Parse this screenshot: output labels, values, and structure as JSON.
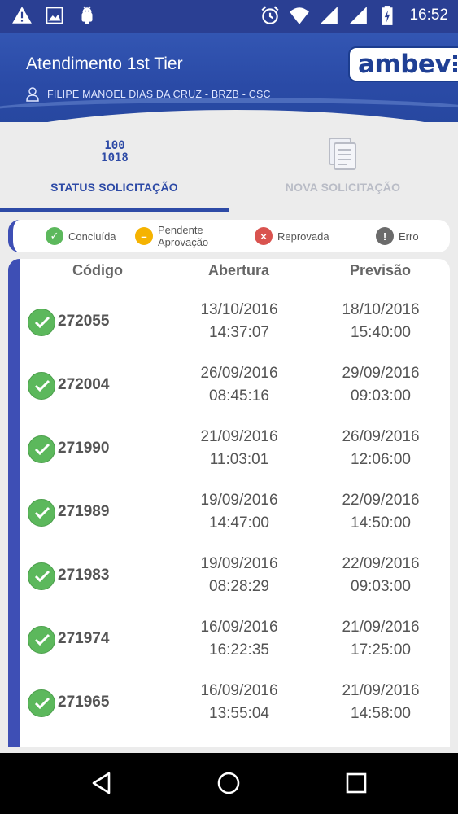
{
  "status_bar": {
    "time": "16:52",
    "left_icons": [
      "warning-icon",
      "image-icon",
      "android-icon"
    ],
    "right_icons": [
      "alarm-icon",
      "wifi-icon",
      "signal-icon",
      "signal-icon",
      "battery-charging-icon"
    ]
  },
  "header": {
    "title": "Atendimento 1st Tier",
    "user": "FILIPE MANOEL DIAS DA CRUZ - BRZB - CSC",
    "logo": "ambev"
  },
  "tabs": [
    {
      "label": "STATUS SOLICITAÇÃO",
      "icon": "binary-icon",
      "active": true,
      "icon_text_top": "100",
      "icon_text_bottom": "1018"
    },
    {
      "label": "NOVA SOLICITAÇÃO",
      "icon": "document-icon",
      "active": false
    }
  ],
  "legend": [
    {
      "label": "Concluída",
      "color": "#5cb85c",
      "glyph": "✓"
    },
    {
      "label": "Pendente Aprovação",
      "color": "#f5b301",
      "glyph": "–"
    },
    {
      "label": "Reprovada",
      "color": "#d9534f",
      "glyph": "×"
    },
    {
      "label": "Erro",
      "color": "#6b6b6b",
      "glyph": "!"
    }
  ],
  "table": {
    "headers": [
      "Código",
      "Abertura",
      "Previsão"
    ],
    "rows": [
      {
        "status": "Concluída",
        "code": "272055",
        "abertura_date": "13/10/2016",
        "abertura_time": "14:37:07",
        "previsao_date": "18/10/2016",
        "previsao_time": "15:40:00"
      },
      {
        "status": "Concluída",
        "code": "272004",
        "abertura_date": "26/09/2016",
        "abertura_time": "08:45:16",
        "previsao_date": "29/09/2016",
        "previsao_time": "09:03:00"
      },
      {
        "status": "Concluída",
        "code": "271990",
        "abertura_date": "21/09/2016",
        "abertura_time": "11:03:01",
        "previsao_date": "26/09/2016",
        "previsao_time": "12:06:00"
      },
      {
        "status": "Concluída",
        "code": "271989",
        "abertura_date": "19/09/2016",
        "abertura_time": "14:47:00",
        "previsao_date": "22/09/2016",
        "previsao_time": "14:50:00"
      },
      {
        "status": "Concluída",
        "code": "271983",
        "abertura_date": "19/09/2016",
        "abertura_time": "08:28:29",
        "previsao_date": "22/09/2016",
        "previsao_time": "09:03:00"
      },
      {
        "status": "Concluída",
        "code": "271974",
        "abertura_date": "16/09/2016",
        "abertura_time": "16:22:35",
        "previsao_date": "21/09/2016",
        "previsao_time": "17:25:00"
      },
      {
        "status": "Concluída",
        "code": "271965",
        "abertura_date": "16/09/2016",
        "abertura_time": "13:55:04",
        "previsao_date": "21/09/2016",
        "previsao_time": "14:58:00"
      }
    ]
  },
  "nav": [
    "back-icon",
    "home-icon",
    "recents-icon"
  ]
}
